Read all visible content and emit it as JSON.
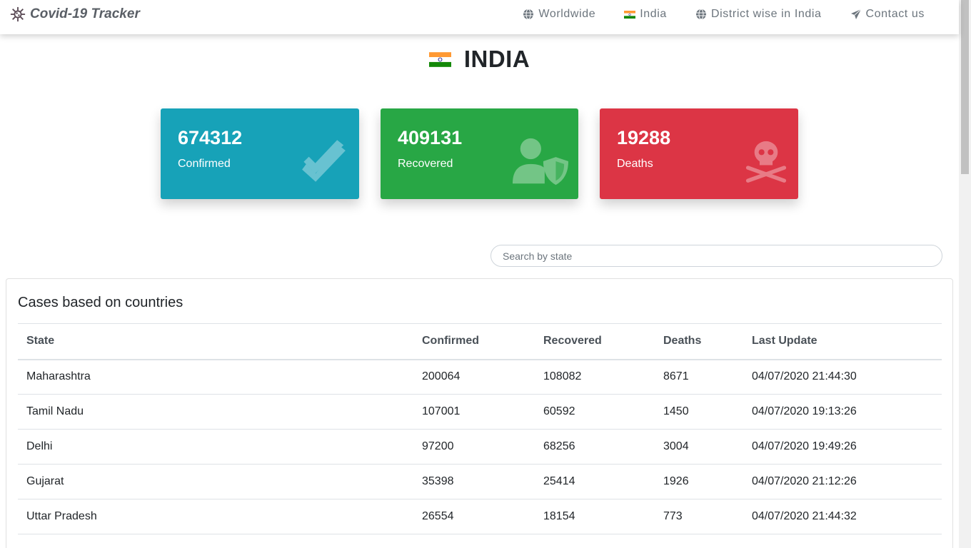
{
  "brand": {
    "title": "Covid-19 Tracker",
    "icon": "virus-icon"
  },
  "nav": {
    "items": [
      {
        "label": "Worldwide",
        "icon": "globe-icon"
      },
      {
        "label": "India",
        "icon": "india-flag-icon"
      },
      {
        "label": "District wise in India",
        "icon": "globe-icon"
      },
      {
        "label": "Contact us",
        "icon": "paper-plane-icon"
      }
    ]
  },
  "page": {
    "title": "INDIA",
    "flag_icon": "india-flag-icon"
  },
  "stats": {
    "confirmed": {
      "value": "674312",
      "label": "Confirmed",
      "color": "#17a2b8",
      "icon": "double-check-icon"
    },
    "recovered": {
      "value": "409131",
      "label": "Recovered",
      "color": "#28a745",
      "icon": "user-shield-icon"
    },
    "deaths": {
      "value": "19288",
      "label": "Deaths",
      "color": "#dc3545",
      "icon": "skull-crossbones-icon"
    }
  },
  "search": {
    "placeholder": "Search by state"
  },
  "table": {
    "title": "Cases based on countries",
    "headers": [
      "State",
      "Confirmed",
      "Recovered",
      "Deaths",
      "Last Update"
    ],
    "rows": [
      [
        "Maharashtra",
        "200064",
        "108082",
        "8671",
        "04/07/2020 21:44:30"
      ],
      [
        "Tamil Nadu",
        "107001",
        "60592",
        "1450",
        "04/07/2020 19:13:26"
      ],
      [
        "Delhi",
        "97200",
        "68256",
        "3004",
        "04/07/2020 19:49:26"
      ],
      [
        "Gujarat",
        "35398",
        "25414",
        "1926",
        "04/07/2020 21:12:26"
      ],
      [
        "Uttar Pradesh",
        "26554",
        "18154",
        "773",
        "04/07/2020 21:44:32"
      ]
    ]
  }
}
